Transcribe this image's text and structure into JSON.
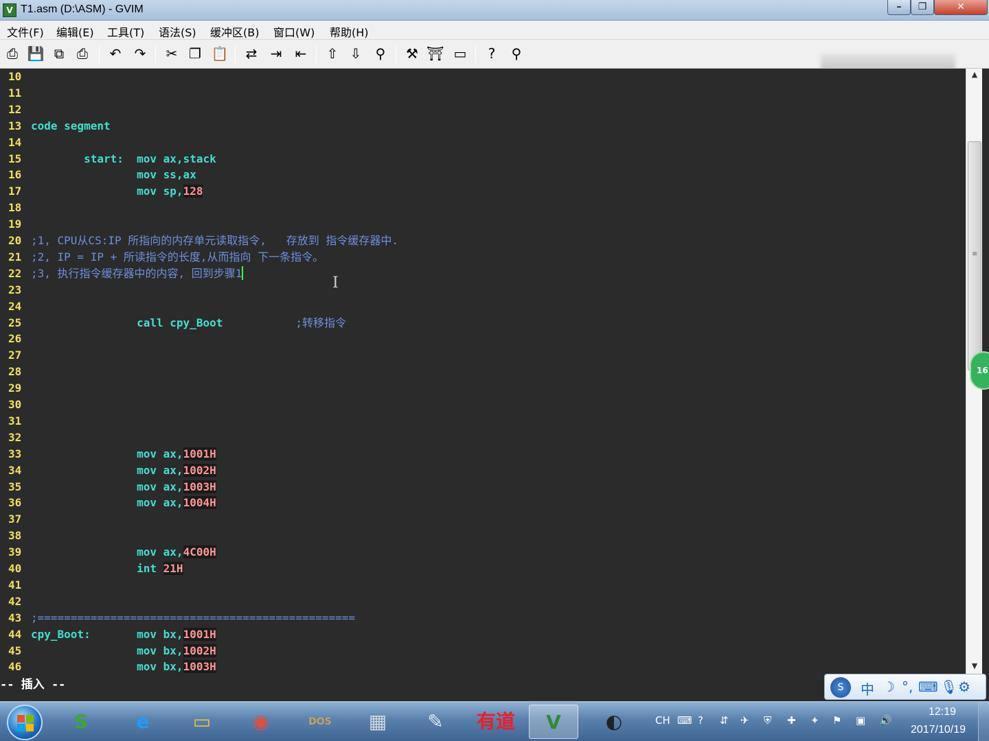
{
  "window": {
    "title": "T1.asm (D:\\ASM) - GVIM",
    "icon": "vim-icon",
    "controls": {
      "minimize": "–",
      "maximize": "❐",
      "close": "✕"
    }
  },
  "menu": [
    {
      "label": "文件(F)"
    },
    {
      "label": "编辑(E)"
    },
    {
      "label": "工具(T)"
    },
    {
      "label": "语法(S)"
    },
    {
      "label": "缓冲区(B)"
    },
    {
      "label": "窗口(W)"
    },
    {
      "label": "帮助(H)"
    }
  ],
  "toolbar": [
    {
      "name": "open-icon",
      "glyph": "⎙"
    },
    {
      "name": "save-icon",
      "glyph": "💾"
    },
    {
      "name": "save-all-icon",
      "glyph": "⧉"
    },
    {
      "name": "print-icon",
      "glyph": "⎙"
    },
    {
      "name": "undo-icon",
      "glyph": "↶"
    },
    {
      "name": "redo-icon",
      "glyph": "↷"
    },
    {
      "name": "cut-icon",
      "glyph": "✂"
    },
    {
      "name": "copy-icon",
      "glyph": "❐"
    },
    {
      "name": "paste-icon",
      "glyph": "📋"
    },
    {
      "name": "replace-icon",
      "glyph": "⇄"
    },
    {
      "name": "find-next-icon",
      "glyph": "⇥"
    },
    {
      "name": "find-prev-icon",
      "glyph": "⇤"
    },
    {
      "name": "load-session-icon",
      "glyph": "⇧"
    },
    {
      "name": "save-session-icon",
      "glyph": "⇩"
    },
    {
      "name": "run-script-icon",
      "glyph": "⚲"
    },
    {
      "name": "make-icon",
      "glyph": "⚒"
    },
    {
      "name": "shell-icon",
      "glyph": "⛩"
    },
    {
      "name": "tags-icon",
      "glyph": "▭"
    },
    {
      "name": "help-icon",
      "glyph": "?"
    },
    {
      "name": "find-help-icon",
      "glyph": "⚲"
    }
  ],
  "editor": {
    "lines": [
      {
        "n": "10",
        "segs": []
      },
      {
        "n": "11",
        "segs": []
      },
      {
        "n": "12",
        "segs": []
      },
      {
        "n": "13",
        "segs": [
          {
            "t": "code segment",
            "c": "kw"
          }
        ]
      },
      {
        "n": "14",
        "segs": []
      },
      {
        "n": "15",
        "segs": [
          {
            "t": "        start:  ",
            "c": "kw"
          },
          {
            "t": "mov ax,stack",
            "c": "kw"
          }
        ]
      },
      {
        "n": "16",
        "segs": [
          {
            "t": "                mov ss,ax",
            "c": "kw"
          }
        ]
      },
      {
        "n": "17",
        "segs": [
          {
            "t": "                mov sp,",
            "c": "kw"
          },
          {
            "t": "128",
            "c": "num"
          }
        ]
      },
      {
        "n": "18",
        "segs": []
      },
      {
        "n": "19",
        "segs": []
      },
      {
        "n": "20",
        "segs": [
          {
            "t": ";1, CPU从CS:IP 所指向的内存单元读取指令,   存放到 指令缓存器中.",
            "c": "cm"
          }
        ]
      },
      {
        "n": "21",
        "segs": [
          {
            "t": ";2, IP = IP + 所读指令的长度,从而指向 下一条指令。",
            "c": "cm"
          }
        ]
      },
      {
        "n": "22",
        "segs": [
          {
            "t": ";3, 执行指令缓存器中的内容, 回到步骤1",
            "c": "cm"
          }
        ],
        "cursor": true
      },
      {
        "n": "23",
        "segs": []
      },
      {
        "n": "24",
        "segs": []
      },
      {
        "n": "25",
        "segs": [
          {
            "t": "                call cpy_Boot",
            "c": "kw"
          },
          {
            "t": "           ;转移指令",
            "c": "cm"
          }
        ]
      },
      {
        "n": "26",
        "segs": []
      },
      {
        "n": "27",
        "segs": []
      },
      {
        "n": "28",
        "segs": []
      },
      {
        "n": "29",
        "segs": []
      },
      {
        "n": "30",
        "segs": []
      },
      {
        "n": "31",
        "segs": []
      },
      {
        "n": "32",
        "segs": []
      },
      {
        "n": "33",
        "segs": [
          {
            "t": "                mov ax,",
            "c": "kw"
          },
          {
            "t": "1001H",
            "c": "num"
          }
        ]
      },
      {
        "n": "34",
        "segs": [
          {
            "t": "                mov ax,",
            "c": "kw"
          },
          {
            "t": "1002H",
            "c": "num"
          }
        ]
      },
      {
        "n": "35",
        "segs": [
          {
            "t": "                mov ax,",
            "c": "kw"
          },
          {
            "t": "1003H",
            "c": "num"
          }
        ]
      },
      {
        "n": "36",
        "segs": [
          {
            "t": "                mov ax,",
            "c": "kw"
          },
          {
            "t": "1004H",
            "c": "num"
          }
        ]
      },
      {
        "n": "37",
        "segs": []
      },
      {
        "n": "38",
        "segs": []
      },
      {
        "n": "39",
        "segs": [
          {
            "t": "                mov ax,",
            "c": "kw"
          },
          {
            "t": "4C00H",
            "c": "num"
          }
        ]
      },
      {
        "n": "40",
        "segs": [
          {
            "t": "                int ",
            "c": "kw"
          },
          {
            "t": "21H",
            "c": "num"
          }
        ]
      },
      {
        "n": "41",
        "segs": []
      },
      {
        "n": "42",
        "segs": []
      },
      {
        "n": "43",
        "segs": [
          {
            "t": ";================================================",
            "c": "cm"
          }
        ]
      },
      {
        "n": "44",
        "segs": [
          {
            "t": "cpy_Boot:       mov bx,",
            "c": "kw"
          },
          {
            "t": "1001H",
            "c": "num"
          }
        ]
      },
      {
        "n": "45",
        "segs": [
          {
            "t": "                mov bx,",
            "c": "kw"
          },
          {
            "t": "1002H",
            "c": "num"
          }
        ]
      },
      {
        "n": "46",
        "segs": [
          {
            "t": "                mov bx,",
            "c": "kw"
          },
          {
            "t": "1003H",
            "c": "num"
          }
        ]
      }
    ]
  },
  "status": {
    "mode": "-- 插入 --"
  },
  "side_badge": "16",
  "ime": {
    "items": [
      {
        "name": "ime-chinese-icon",
        "glyph": "中"
      },
      {
        "name": "ime-moon-icon",
        "glyph": "☽"
      },
      {
        "name": "ime-punct-icon",
        "glyph": "°,"
      },
      {
        "name": "ime-keyboard-icon",
        "glyph": "⌨"
      },
      {
        "name": "ime-mic-icon",
        "glyph": "🎙"
      },
      {
        "name": "ime-settings-icon",
        "glyph": "⚙"
      }
    ]
  },
  "taskbar": {
    "apps": [
      {
        "name": "sogou-icon",
        "glyph": "S",
        "color": "#3fa535"
      },
      {
        "name": "ie-icon",
        "glyph": "e",
        "color": "#1e9bff"
      },
      {
        "name": "explorer-icon",
        "glyph": "▭",
        "color": "#f0c040"
      },
      {
        "name": "chrome-icon",
        "glyph": "◉",
        "color": "#e84b3c"
      },
      {
        "name": "dosbox-icon",
        "glyph": "DOS",
        "color": "#c8a060"
      },
      {
        "name": "calculator-icon",
        "glyph": "▦",
        "color": "#d0d8e0"
      },
      {
        "name": "paint-icon",
        "glyph": "✎",
        "color": "#e0e8f0"
      },
      {
        "name": "youdao-icon",
        "glyph": "有道",
        "color": "#e8202a"
      },
      {
        "name": "gvim-icon",
        "glyph": "V",
        "color": "#2e8b3a"
      },
      {
        "name": "obs-icon",
        "glyph": "◐",
        "color": "#222222"
      }
    ],
    "tray": {
      "lang": "CH",
      "clock_time": "12:19",
      "clock_date": "2017/10/19"
    }
  },
  "colors": {
    "editor_bg": "#2b2b2b",
    "line_number": "#f0e060",
    "keyword": "#40e0d0",
    "number": "#ff9696",
    "comment": "#6e8ee0",
    "cursor": "#40ff40"
  }
}
